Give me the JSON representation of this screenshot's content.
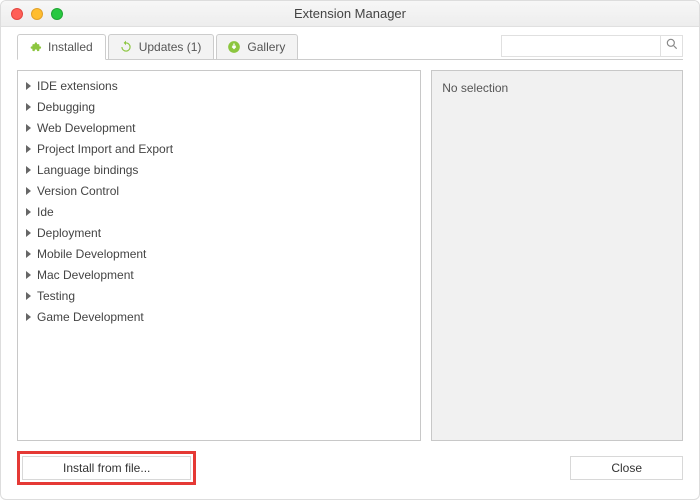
{
  "window": {
    "title": "Extension Manager"
  },
  "tabs": {
    "installed": {
      "label": "Installed"
    },
    "updates": {
      "label": "Updates (1)"
    },
    "gallery": {
      "label": "Gallery"
    }
  },
  "search": {
    "placeholder": ""
  },
  "categories": [
    "IDE extensions",
    "Debugging",
    "Web Development",
    "Project Import and Export",
    "Language bindings",
    "Version Control",
    "Ide",
    "Deployment",
    "Mobile Development",
    "Mac Development",
    "Testing",
    "Game Development"
  ],
  "detail": {
    "no_selection": "No selection"
  },
  "footer": {
    "install_from_file": "Install from file...",
    "close": "Close"
  },
  "icons": {
    "puzzle": "puzzle-icon",
    "refresh": "refresh-icon",
    "down": "download-icon",
    "search": "search-icon"
  },
  "colors": {
    "accent_green": "#8CC63F"
  }
}
